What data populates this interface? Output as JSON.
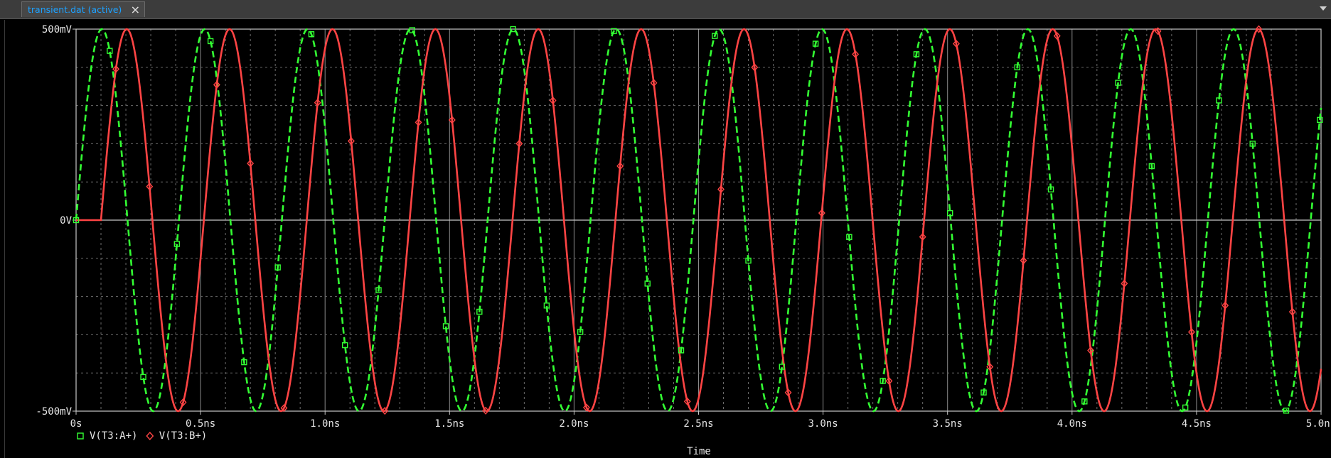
{
  "tab": {
    "title": "transient.dat (active)",
    "close_glyph": "×"
  },
  "chart_data": {
    "type": "line",
    "xlabel": "Time",
    "xlim": [
      0,
      5.0
    ],
    "ylim": [
      -500,
      500
    ],
    "x_unit": "ns",
    "y_unit": "mV",
    "x_ticks": [
      0,
      0.5,
      1.0,
      1.5,
      2.0,
      2.5,
      3.0,
      3.5,
      4.0,
      4.5,
      5.0
    ],
    "x_tick_labels": [
      "0s",
      "0.5ns",
      "1.0ns",
      "1.5ns",
      "2.0ns",
      "2.5ns",
      "3.0ns",
      "3.5ns",
      "4.0ns",
      "4.5ns",
      "5.0ns"
    ],
    "y_ticks": [
      -500,
      0,
      500
    ],
    "y_tick_labels": [
      "-500mV",
      "0V",
      "500mV"
    ],
    "grid": true,
    "legend_position": "bottom-left",
    "series": [
      {
        "name": "V(T3:A+)",
        "color": "#33ff33",
        "style": "dashed",
        "marker": "square",
        "amplitude": 500,
        "frequency_ghz": 2.42,
        "start_time": 0,
        "start_value": 0
      },
      {
        "name": "V(T3:B+)",
        "color": "#ff4444",
        "style": "solid",
        "marker": "diamond",
        "amplitude": 500,
        "frequency_ghz": 2.42,
        "start_time": 0.1,
        "start_value": 0
      }
    ]
  }
}
